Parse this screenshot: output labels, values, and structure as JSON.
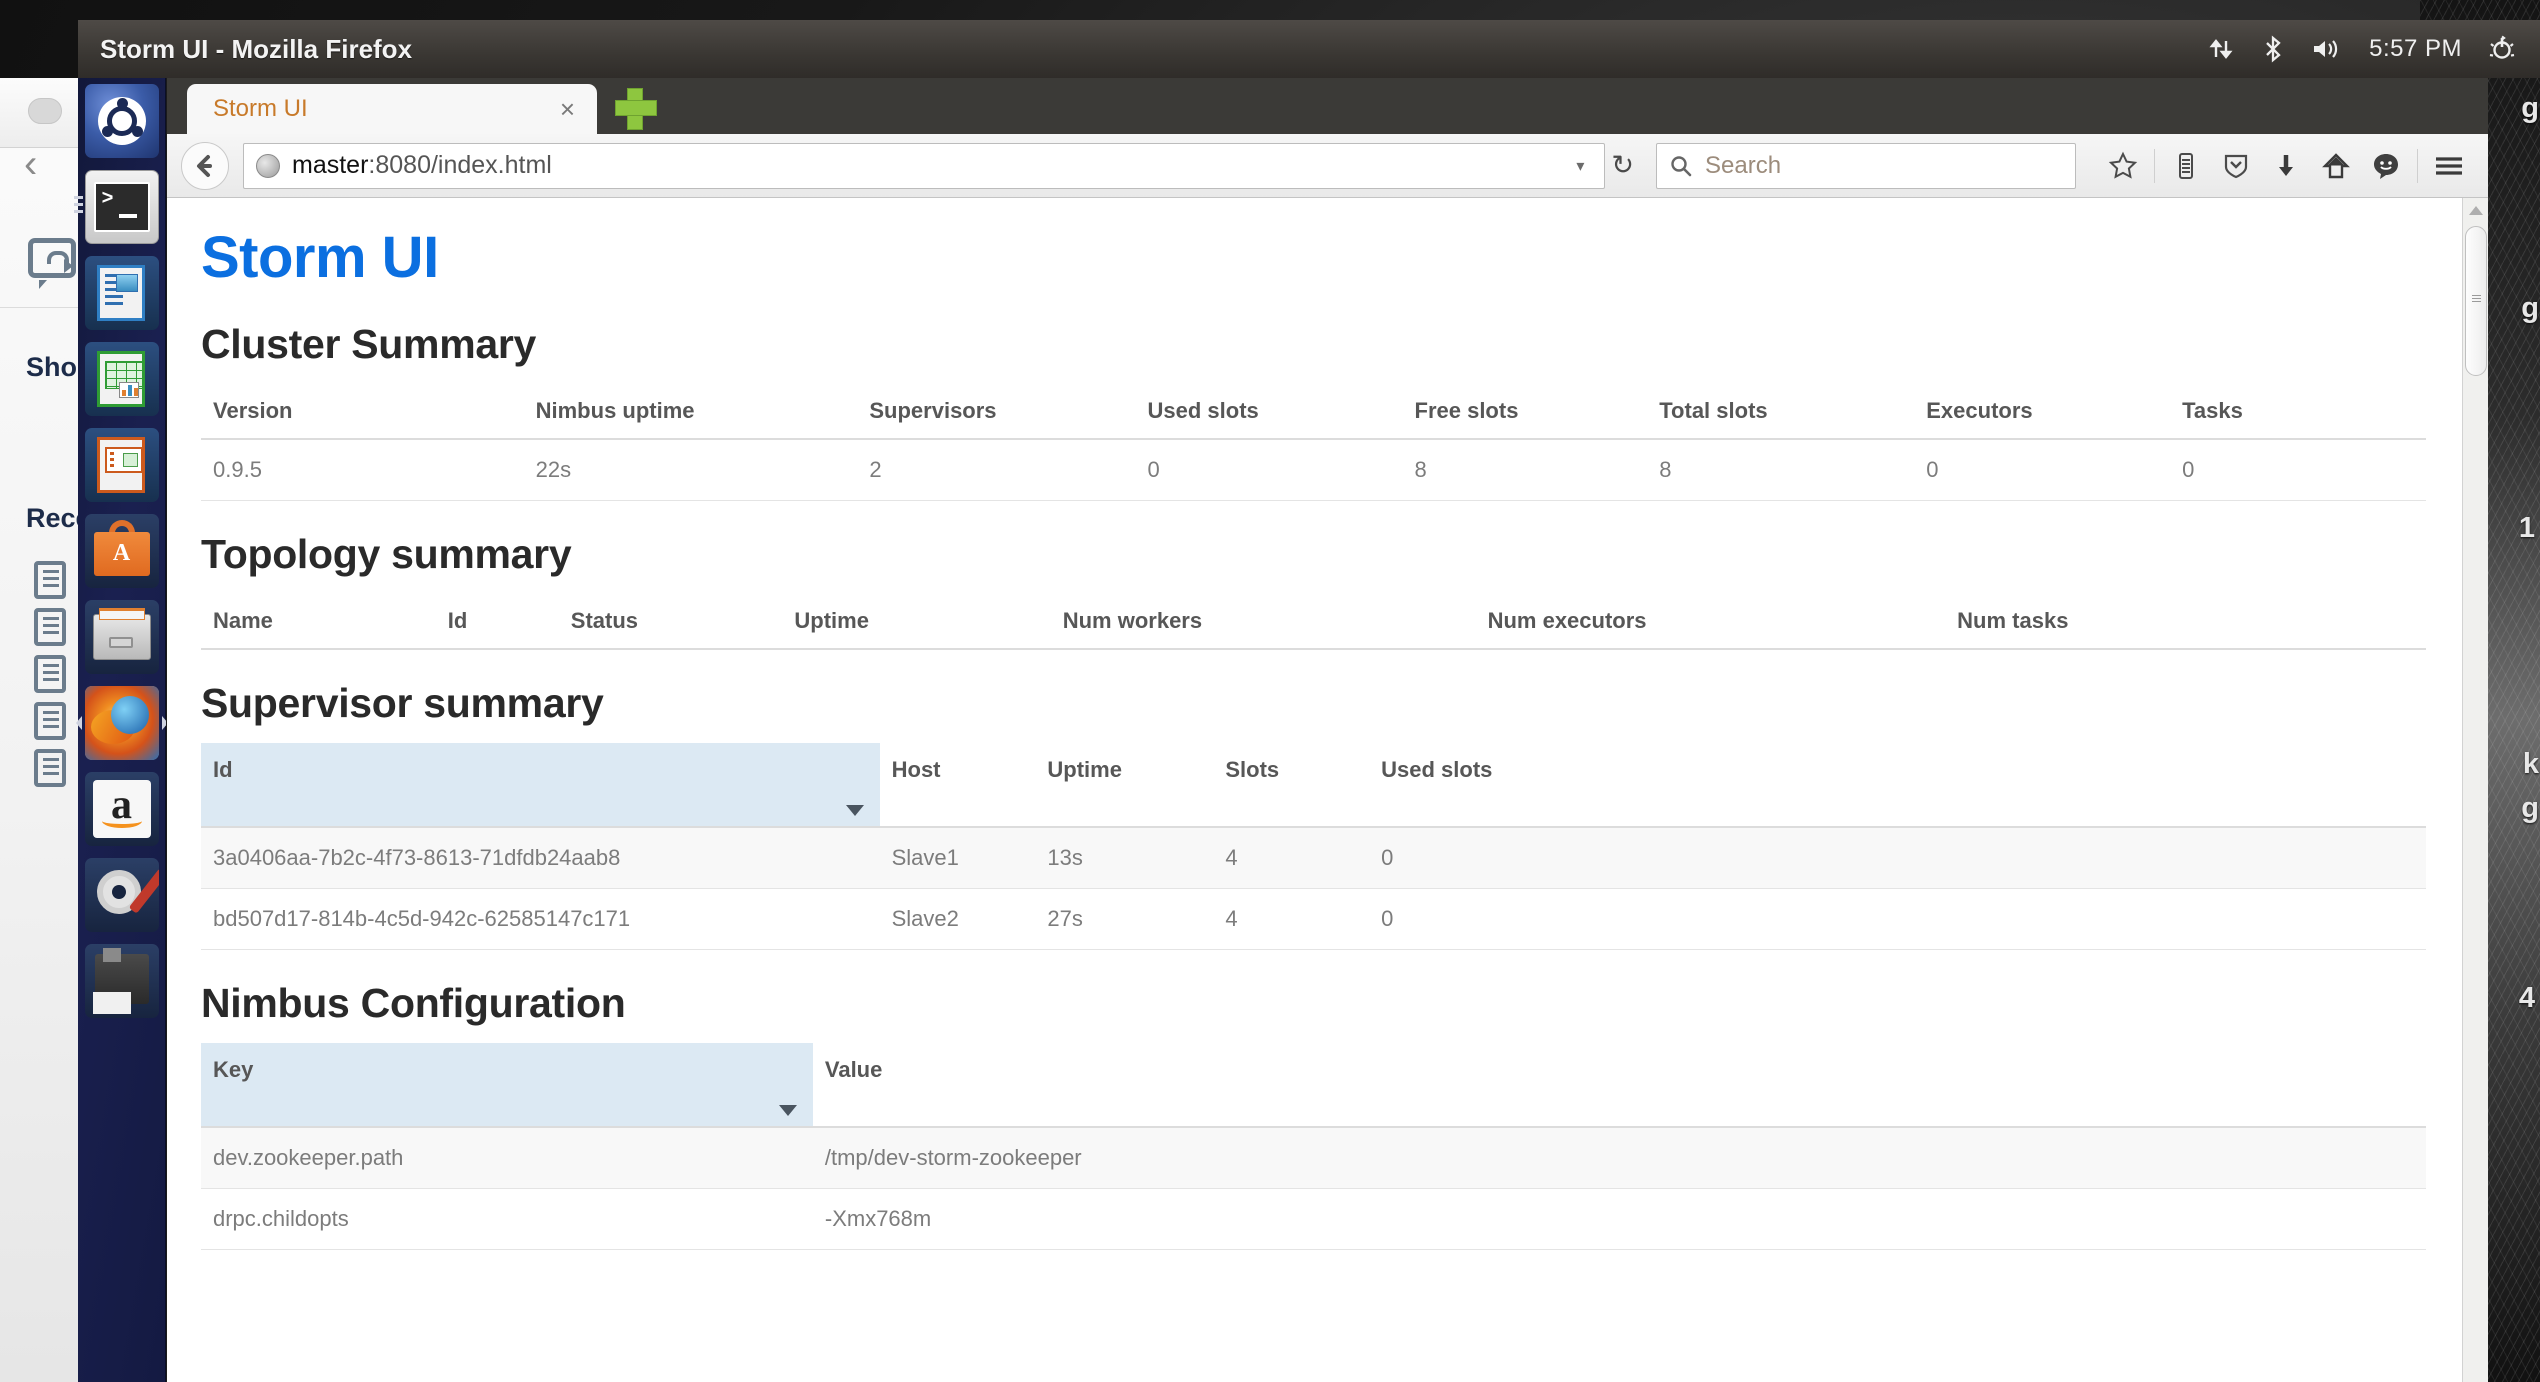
{
  "window": {
    "title": "Storm UI - Mozilla Firefox"
  },
  "tray": {
    "network_icon": "network-updown-icon",
    "bluetooth_icon": "bluetooth-icon",
    "volume_icon": "volume-icon",
    "clock": "5:57 PM",
    "power_icon": "power-gear-icon"
  },
  "browser": {
    "tab": {
      "label": "Storm UI",
      "close_label": "×"
    },
    "new_tab_label": "+",
    "back_label": "←",
    "url": {
      "host": "master",
      "rest": ":8080/index.html"
    },
    "url_dropdown_label": "▾",
    "reload_label": "↻",
    "search": {
      "placeholder": "Search",
      "icon": "search-icon"
    },
    "toolbar_icons": [
      "bookmark-star-icon",
      "reading-list-icon",
      "pocket-shield-icon",
      "downloads-arrow-icon",
      "home-icon",
      "feedback-smiley-icon",
      "hamburger-menu-icon"
    ]
  },
  "page": {
    "brand": "Storm UI",
    "cluster_summary": {
      "heading": "Cluster Summary",
      "columns": [
        "Version",
        "Nimbus uptime",
        "Supervisors",
        "Used slots",
        "Free slots",
        "Total slots",
        "Executors",
        "Tasks"
      ],
      "rows": [
        [
          "0.9.5",
          "22s",
          "2",
          "0",
          "8",
          "8",
          "0",
          "0"
        ]
      ]
    },
    "topology_summary": {
      "heading": "Topology summary",
      "columns": [
        "Name",
        "Id",
        "Status",
        "Uptime",
        "Num workers",
        "Num executors",
        "Num tasks"
      ],
      "rows": []
    },
    "supervisor_summary": {
      "heading": "Supervisor summary",
      "columns": [
        "Id",
        "Host",
        "Uptime",
        "Slots",
        "Used slots"
      ],
      "sorted_column": "Id",
      "sort_direction": "descending",
      "rows": [
        [
          "3a0406aa-7b2c-4f73-8613-71dfdb24aab8",
          "Slave1",
          "13s",
          "4",
          "0"
        ],
        [
          "bd507d17-814b-4c5d-942c-62585147c171",
          "Slave2",
          "27s",
          "4",
          "0"
        ]
      ]
    },
    "nimbus_configuration": {
      "heading": "Nimbus Configuration",
      "columns": [
        "Key",
        "Value"
      ],
      "sorted_column": "Key",
      "sort_direction": "descending",
      "rows": [
        [
          "dev.zookeeper.path",
          "/tmp/dev-storm-zookeeper"
        ],
        [
          "drpc.childopts",
          "-Xmx768m"
        ]
      ]
    }
  },
  "launcher": {
    "items": [
      {
        "name": "ubuntu-dash",
        "state": "pinned"
      },
      {
        "name": "terminal",
        "state": "running"
      },
      {
        "name": "libreoffice-writer",
        "state": "pinned"
      },
      {
        "name": "libreoffice-calc",
        "state": "pinned"
      },
      {
        "name": "libreoffice-impress",
        "state": "pinned"
      },
      {
        "name": "ubuntu-software-center",
        "state": "pinned"
      },
      {
        "name": "files",
        "state": "pinned"
      },
      {
        "name": "firefox",
        "state": "focused"
      },
      {
        "name": "amazon",
        "state": "pinned"
      },
      {
        "name": "system-settings",
        "state": "pinned"
      },
      {
        "name": "backup-disk",
        "state": "pinned"
      }
    ]
  },
  "background_window": {
    "back_label": "‹",
    "shortcuts_heading": "Shor",
    "recent_heading": "Rece"
  },
  "desktop": {
    "texts": [
      "g",
      "g",
      "1",
      "k",
      "g",
      "4"
    ]
  }
}
